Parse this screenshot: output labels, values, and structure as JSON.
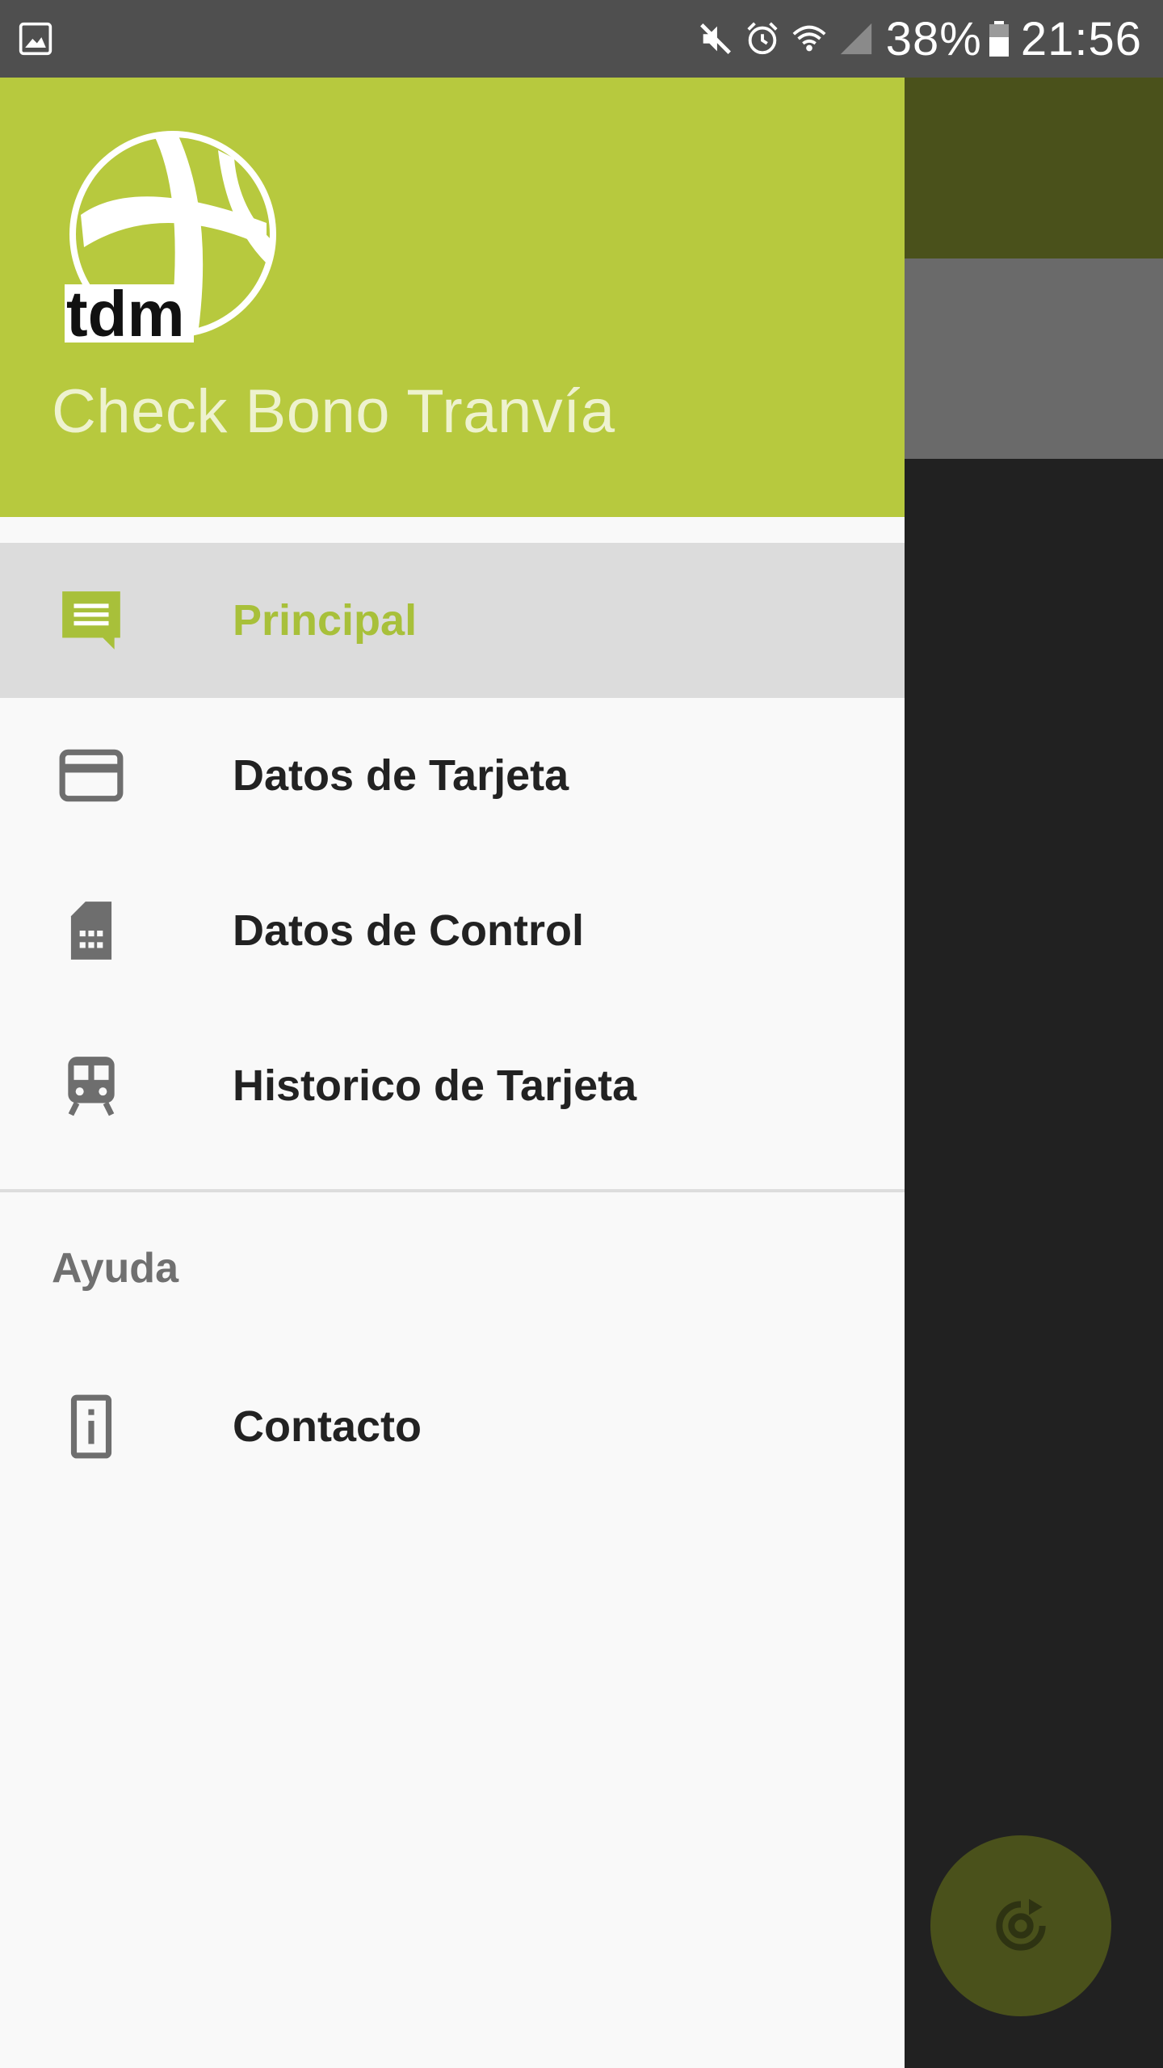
{
  "status_bar": {
    "battery_percent": "38%",
    "time": "21:56",
    "icons": [
      "image-icon",
      "mute-icon",
      "alarm-icon",
      "wifi-icon",
      "signal-icon",
      "battery-icon"
    ]
  },
  "drawer": {
    "header": {
      "logo_text": "tdm",
      "title": "Check Bono Tranvía",
      "color": "#b7c93e"
    },
    "items": [
      {
        "label": "Principal",
        "icon": "message-icon",
        "selected": true
      },
      {
        "label": "Datos de Tarjeta",
        "icon": "credit-card-icon",
        "selected": false
      },
      {
        "label": "Datos de Control",
        "icon": "sim-card-icon",
        "selected": false
      },
      {
        "label": "Historico de Tarjeta",
        "icon": "train-icon",
        "selected": false
      }
    ],
    "section_title": "Ayuda",
    "help_items": [
      {
        "label": "Contacto",
        "icon": "info-icon"
      }
    ]
  },
  "fab": {
    "icon": "refresh-icon"
  },
  "colors": {
    "accent": "#b7c93e",
    "selected_text": "#a8c03a",
    "status_bar": "#4f4f4f"
  }
}
